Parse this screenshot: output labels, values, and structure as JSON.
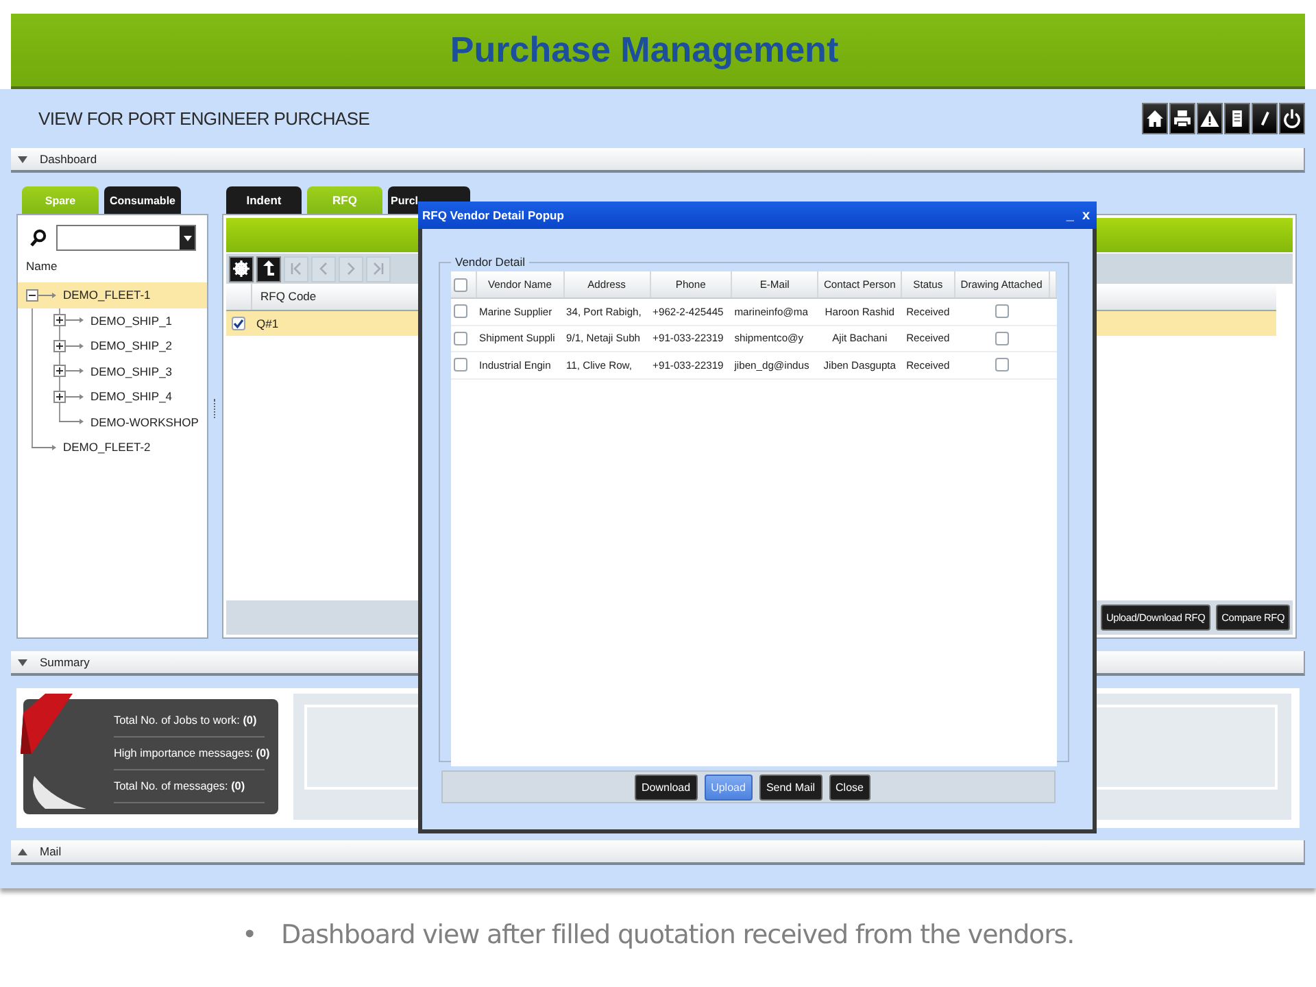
{
  "slide_title": "Purchase Management",
  "view_title": "VIEW FOR PORT ENGINEER PURCHASE",
  "dashboard_bar": {
    "title": "Dashboard",
    "expanded": true
  },
  "left_panel": {
    "tabs": [
      {
        "label": "Spare",
        "selected": true
      },
      {
        "label": "Consumable",
        "selected": false
      }
    ],
    "column": "Name",
    "tree": [
      {
        "label": "DEMO_FLEET-1",
        "expanded": true,
        "selected": true,
        "children": [
          {
            "label": "DEMO_SHIP_1",
            "expanded": false,
            "selected": false
          },
          {
            "label": "DEMO_SHIP_2",
            "expanded": false,
            "selected": false
          },
          {
            "label": "DEMO_SHIP_3",
            "expanded": false,
            "selected": false
          },
          {
            "label": "DEMO_SHIP_4",
            "expanded": false,
            "selected": false
          },
          {
            "label": "DEMO-WORKSHOP",
            "selected": false
          }
        ]
      },
      {
        "label": "DEMO_FLEET-2",
        "selected": false
      }
    ]
  },
  "rfq_panel": {
    "tabs": [
      {
        "label": "Indent",
        "selected": false
      },
      {
        "label": "RFQ",
        "selected": true
      },
      {
        "label": "Purcl",
        "selected": false
      }
    ],
    "pager_disabled": true,
    "column": "RFQ Code",
    "rows": [
      {
        "code": "Q#1",
        "checked": true,
        "selected": true
      }
    ],
    "buttons": [
      "Upload/Download RFQ",
      "Compare RFQ"
    ]
  },
  "summary_bar": {
    "title": "Summary",
    "expanded": true
  },
  "summary": {
    "lines": [
      "Total No. of Jobs to work: **(0)**",
      "High importance messages: **(0)**",
      "Total No. of messages: **(0)**"
    ]
  },
  "mail_bar": {
    "title": "Mail",
    "expanded": false
  },
  "popup": {
    "title": "RFQ Vendor Detail Popup",
    "controls": [
      "_",
      "x"
    ],
    "group": "Vendor Detail",
    "header_checked": false,
    "columns": [
      "Vendor Name",
      "Address",
      "Phone",
      "E-Mail",
      "Contact Person",
      "Status",
      "Drawing Attached"
    ],
    "rows": [
      {
        "checked": false,
        "cells": [
          "Marine Supplier",
          "34, Port Rabigh,",
          "+962-2-425445",
          "marineinfo@ma",
          "Haroon Rashid",
          "Received"
        ],
        "drawing_attached": false
      },
      {
        "checked": false,
        "cells": [
          "Shipment Suppli",
          "9/1, Netaji Subh",
          "+91-033-22319",
          "shipmentco@y",
          "Ajit Bachani",
          "Received"
        ],
        "drawing_attached": false
      },
      {
        "checked": false,
        "cells": [
          "Industrial Engin",
          "11, Clive Row,",
          "+91-033-22319",
          "jiben_dg@indus",
          "Jiben Dasgupta",
          "Received"
        ],
        "drawing_attached": false
      }
    ],
    "buttons": [
      {
        "label": "Download",
        "active": false
      },
      {
        "label": "Upload",
        "active": true
      },
      {
        "label": "Send Mail",
        "active": false
      },
      {
        "label": "Close",
        "active": false
      }
    ]
  },
  "caption": {
    "bullet": "•",
    "text": "Dashboard view after filled quotation received from the vendors."
  }
}
